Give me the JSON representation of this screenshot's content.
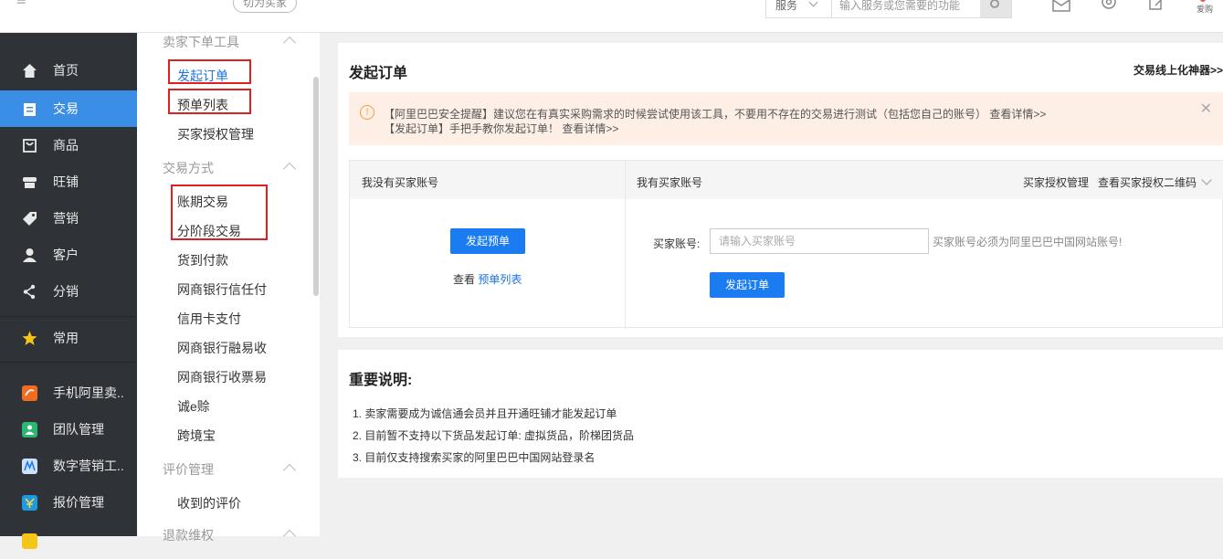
{
  "topbar": {
    "switch_label": "切为买家",
    "search_scope": "服务",
    "search_placeholder": "输入服务或您需要的功能",
    "avatar_label": "爱购"
  },
  "leftnav": {
    "items": [
      {
        "label": "首页",
        "icon": "home-icon"
      },
      {
        "label": "交易",
        "icon": "clipboard-icon",
        "active": true
      },
      {
        "label": "商品",
        "icon": "bag-icon"
      },
      {
        "label": "旺铺",
        "icon": "store-icon"
      },
      {
        "label": "营销",
        "icon": "tag-icon"
      },
      {
        "label": "客户",
        "icon": "user-icon"
      },
      {
        "label": "分销",
        "icon": "distribution-icon"
      },
      {
        "label": "常用",
        "icon": "star-icon"
      },
      {
        "label": "手机阿里卖..",
        "icon": "mobile-app-icon"
      },
      {
        "label": "团队管理",
        "icon": "team-icon"
      },
      {
        "label": "数字营销工..",
        "icon": "digital-marketing-icon"
      },
      {
        "label": "报价管理",
        "icon": "quote-icon"
      }
    ]
  },
  "subnav": {
    "section1": "卖家下单工具",
    "s1_items": [
      "发起订单",
      "预单列表",
      "买家授权管理"
    ],
    "section2": "交易方式",
    "s2_items": [
      "账期交易",
      "分阶段交易",
      "货到付款",
      "网商银行信任付",
      "信用卡支付",
      "网商银行融易收",
      "网商银行收票易",
      "诚e赊",
      "跨境宝"
    ],
    "section3": "评价管理",
    "s3_items": [
      "收到的评价"
    ],
    "section4": "退款维权"
  },
  "main": {
    "title": "发起订单",
    "topright_link": "交易线上化神器>>",
    "notice_line1": "【阿里巴巴安全提醒】建议您在有真实采购需求的时候尝试使用该工具，不要用不存在的交易进行测试（包括您自己的账号） 查看详情>>",
    "notice_line2": "【发起订单】手把手教你发起订单！ 查看详情>>",
    "col1_header": "我没有买家账号",
    "col2_header": "我有买家账号",
    "auth_manage": "买家授权管理",
    "auth_qr": "查看买家授权二维码",
    "preorder_btn": "发起预单",
    "view_prefix": "查看",
    "view_link": "预单列表",
    "account_label": "买家账号:",
    "account_placeholder": "请输入买家账号",
    "account_hint": "买家账号必须为阿里巴巴中国网站账号!",
    "order_btn": "发起订单",
    "important_title": "重要说明:",
    "important_items": [
      "1. 卖家需要成为诚信通会员并且开通旺铺才能发起订单",
      "2. 目前暂不支持以下货品发起订单: 虚拟货品，阶梯团货品",
      "3. 目前仅支持搜索买家的阿里巴巴中国网站登录名"
    ]
  },
  "colors": {
    "accent": "#1a7cf0",
    "nav_bg": "#2f3237",
    "nav_active": "#3a8ee6",
    "annotation": "#e02020"
  }
}
